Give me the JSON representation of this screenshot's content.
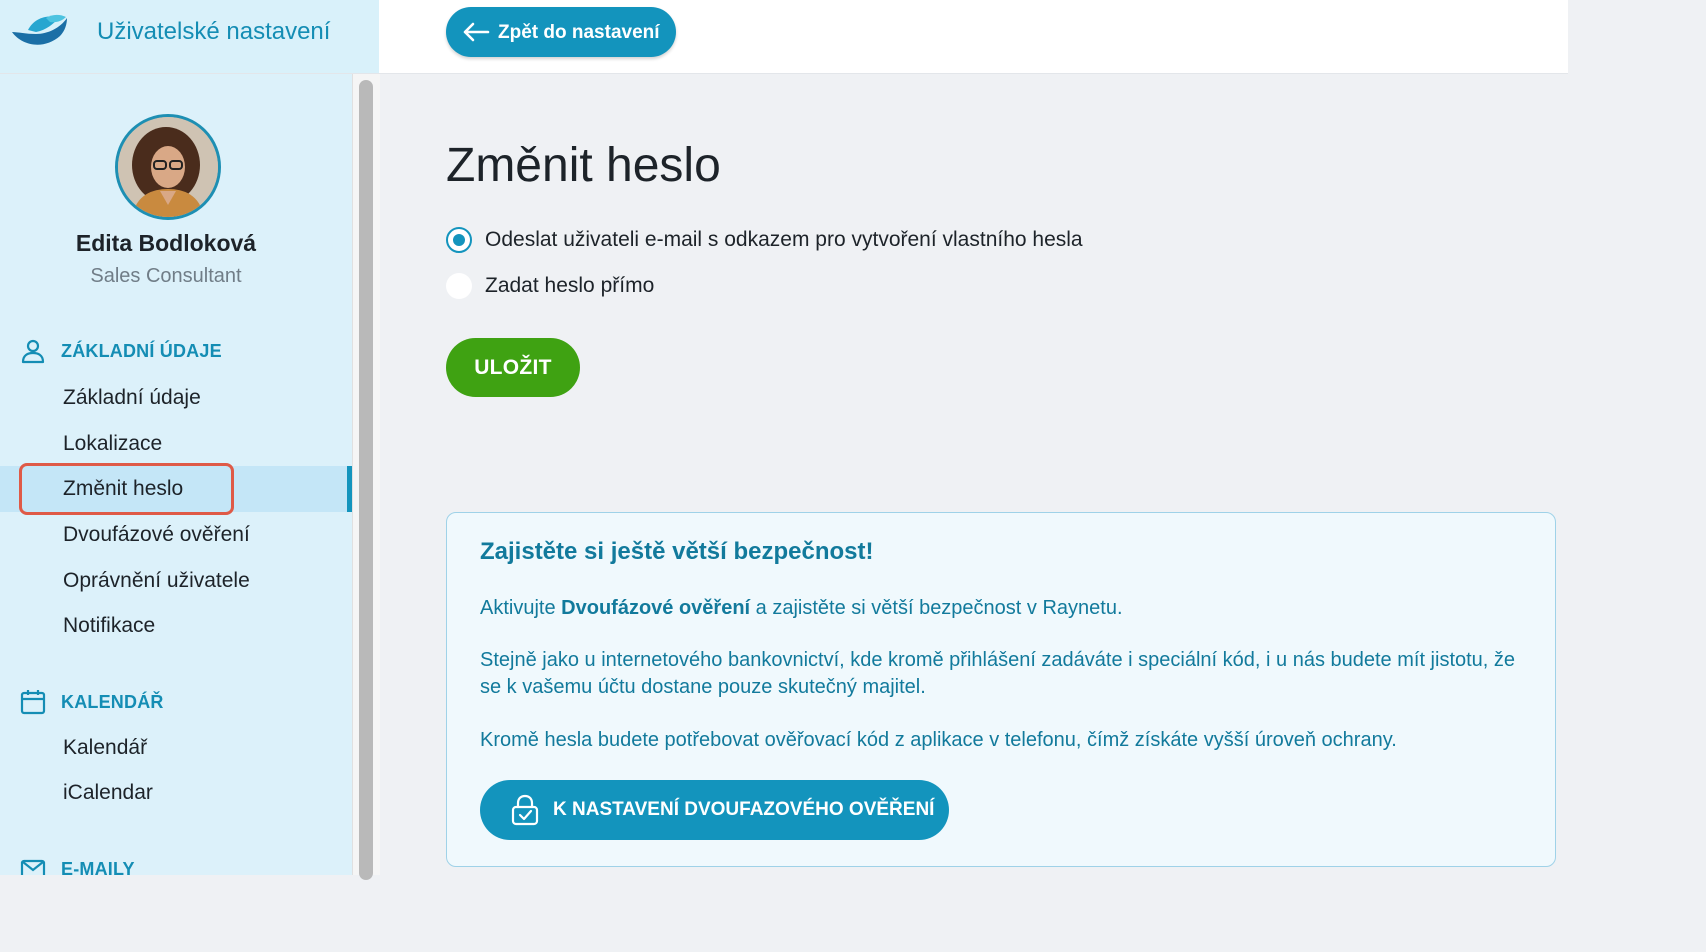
{
  "header": {
    "app_title": "Uživatelské nastavení",
    "back_button_label": "Zpět do nastavení"
  },
  "sidebar": {
    "user": {
      "name": "Edita Bodloková",
      "role": "Sales Consultant"
    },
    "sections": [
      {
        "title": "ZÁKLADNÍ ÚDAJE",
        "icon": "person-icon",
        "items": [
          "Základní údaje",
          "Lokalizace",
          "Změnit heslo",
          "Dvoufázové ověření",
          "Oprávnění uživatele",
          "Notifikace"
        ]
      },
      {
        "title": "KALENDÁŘ",
        "icon": "calendar-icon",
        "items": [
          "Kalendář",
          "iCalendar"
        ]
      },
      {
        "title": "E-MAILY",
        "icon": "mail-icon",
        "items": []
      }
    ],
    "active_item": "Změnit heslo"
  },
  "main": {
    "title": "Změnit heslo",
    "options": [
      {
        "label": "Odeslat uživateli e-mail s odkazem pro vytvoření vlastního hesla",
        "checked": true
      },
      {
        "label": "Zadat heslo přímo",
        "checked": false
      }
    ],
    "save_label": "ULOŽIT",
    "info": {
      "title": "Zajistěte si ještě větší bezpečnost!",
      "p1_before": "Aktivujte ",
      "p1_bold": "Dvoufázové ověření",
      "p1_after": " a zajistěte si větší bezpečnost v Raynetu.",
      "p2": "Stejně jako u internetového bankovnictví, kde kromě přihlášení zadáváte i speciální kód, i u nás budete mít jistotu, že se k vašemu účtu dostane pouze skutečný majitel.",
      "p3": "Kromě hesla budete potřebovat ověřovací kód z aplikace v telefonu, čímž získáte vyšší úroveň ochrany.",
      "button_label": "K NASTAVENÍ DVOUFAZOVÉHO OVĚŘENÍ"
    }
  },
  "colors": {
    "accent": "#1394bd",
    "save_green": "#3fa212",
    "sidebar_bg": "#dcf1fa",
    "highlight": "#df5a47"
  }
}
